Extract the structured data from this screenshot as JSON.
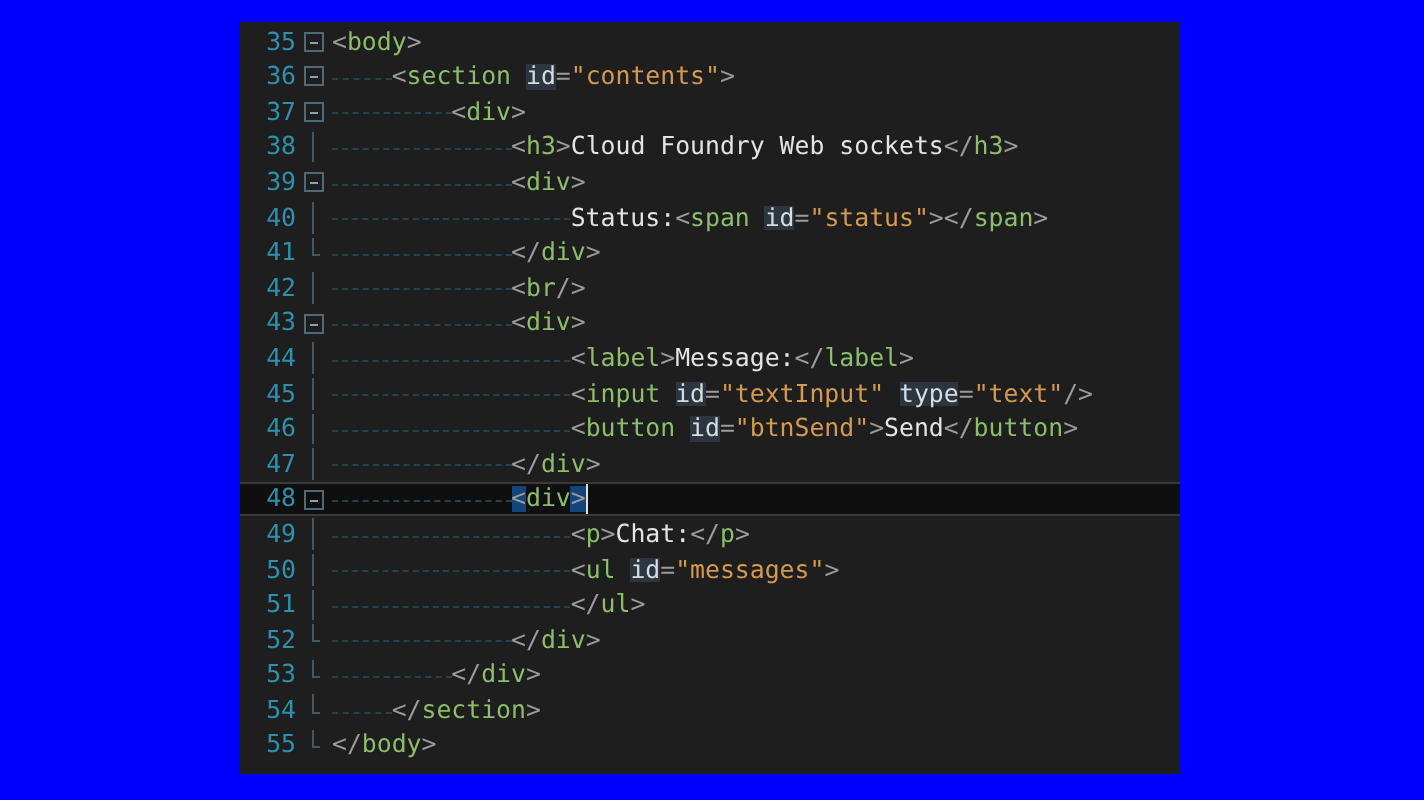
{
  "editor": {
    "lines": [
      {
        "number": "35",
        "collapsible": true,
        "block_end": false,
        "current": false,
        "tokens": [
          {
            "kind": "punct",
            "text": "<"
          },
          {
            "kind": "tag",
            "text": "body"
          },
          {
            "kind": "punct",
            "text": ">"
          }
        ],
        "children": [
          {
            "number": "36",
            "collapsible": true,
            "block_end": false,
            "current": false,
            "tokens": [
              {
                "kind": "punct",
                "text": "<"
              },
              {
                "kind": "tag",
                "text": "section "
              },
              {
                "kind": "attr",
                "text": "id"
              },
              {
                "kind": "punct",
                "text": "="
              },
              {
                "kind": "string",
                "text": "\"contents\""
              },
              {
                "kind": "punct",
                "text": ">"
              }
            ],
            "children": [
              {
                "number": "37",
                "collapsible": true,
                "block_end": false,
                "current": false,
                "tokens": [
                  {
                    "kind": "punct",
                    "text": "<"
                  },
                  {
                    "kind": "tag",
                    "text": "div"
                  },
                  {
                    "kind": "punct",
                    "text": ">"
                  }
                ],
                "children": [
                  {
                    "number": "38",
                    "collapsible": false,
                    "block_end": false,
                    "current": false,
                    "tokens": [
                      {
                        "kind": "punct",
                        "text": "<"
                      },
                      {
                        "kind": "tag",
                        "text": "h3"
                      },
                      {
                        "kind": "punct",
                        "text": ">"
                      },
                      {
                        "kind": "text",
                        "text": "Cloud Foundry Web sockets"
                      },
                      {
                        "kind": "punct",
                        "text": "</"
                      },
                      {
                        "kind": "tag",
                        "text": "h3"
                      },
                      {
                        "kind": "punct",
                        "text": ">"
                      }
                    ]
                  },
                  {
                    "number": "39",
                    "collapsible": true,
                    "block_end": false,
                    "current": false,
                    "tokens": [
                      {
                        "kind": "punct",
                        "text": "<"
                      },
                      {
                        "kind": "tag",
                        "text": "div"
                      },
                      {
                        "kind": "punct",
                        "text": ">"
                      }
                    ],
                    "children": [
                      {
                        "number": "40",
                        "collapsible": false,
                        "block_end": false,
                        "current": false,
                        "tokens": [
                          {
                            "kind": "text",
                            "text": "Status:"
                          },
                          {
                            "kind": "punct",
                            "text": "<"
                          },
                          {
                            "kind": "tag",
                            "text": "span "
                          },
                          {
                            "kind": "attr",
                            "text": "id"
                          },
                          {
                            "kind": "punct",
                            "text": "="
                          },
                          {
                            "kind": "string",
                            "text": "\"status\""
                          },
                          {
                            "kind": "punct",
                            "text": "></"
                          },
                          {
                            "kind": "tag",
                            "text": "span"
                          },
                          {
                            "kind": "punct",
                            "text": ">"
                          }
                        ]
                      }
                    ]
                  },
                  {
                    "number": "41",
                    "collapsible": false,
                    "block_end": true,
                    "current": false,
                    "tokens": [
                      {
                        "kind": "punct",
                        "text": "</"
                      },
                      {
                        "kind": "tag",
                        "text": "div"
                      },
                      {
                        "kind": "punct",
                        "text": ">"
                      }
                    ]
                  },
                  {
                    "number": "42",
                    "collapsible": false,
                    "block_end": false,
                    "current": false,
                    "tokens": [
                      {
                        "kind": "punct",
                        "text": "<"
                      },
                      {
                        "kind": "tag",
                        "text": "br"
                      },
                      {
                        "kind": "punct",
                        "text": "/>"
                      }
                    ]
                  },
                  {
                    "number": "43",
                    "collapsible": true,
                    "block_end": false,
                    "current": false,
                    "tokens": [
                      {
                        "kind": "punct",
                        "text": "<"
                      },
                      {
                        "kind": "tag",
                        "text": "div"
                      },
                      {
                        "kind": "punct",
                        "text": ">"
                      }
                    ],
                    "children": [
                      {
                        "number": "44",
                        "collapsible": false,
                        "block_end": false,
                        "current": false,
                        "tokens": [
                          {
                            "kind": "punct",
                            "text": "<"
                          },
                          {
                            "kind": "tag",
                            "text": "label"
                          },
                          {
                            "kind": "punct",
                            "text": ">"
                          },
                          {
                            "kind": "text",
                            "text": "Message:"
                          },
                          {
                            "kind": "punct",
                            "text": "</"
                          },
                          {
                            "kind": "tag",
                            "text": "label"
                          },
                          {
                            "kind": "punct",
                            "text": ">"
                          }
                        ]
                      },
                      {
                        "number": "45",
                        "collapsible": false,
                        "block_end": false,
                        "current": false,
                        "tokens": [
                          {
                            "kind": "punct",
                            "text": "<"
                          },
                          {
                            "kind": "tag",
                            "text": "input "
                          },
                          {
                            "kind": "attr",
                            "text": "id"
                          },
                          {
                            "kind": "punct",
                            "text": "="
                          },
                          {
                            "kind": "string",
                            "text": "\"textInput\" "
                          },
                          {
                            "kind": "attr",
                            "text": "type"
                          },
                          {
                            "kind": "punct",
                            "text": "="
                          },
                          {
                            "kind": "string",
                            "text": "\"text\""
                          },
                          {
                            "kind": "punct",
                            "text": "/>"
                          }
                        ]
                      },
                      {
                        "number": "46",
                        "collapsible": false,
                        "block_end": false,
                        "current": false,
                        "tokens": [
                          {
                            "kind": "punct",
                            "text": "<"
                          },
                          {
                            "kind": "tag",
                            "text": "button "
                          },
                          {
                            "kind": "attr",
                            "text": "id"
                          },
                          {
                            "kind": "punct",
                            "text": "="
                          },
                          {
                            "kind": "string",
                            "text": "\"btnSend\""
                          },
                          {
                            "kind": "punct",
                            "text": ">"
                          },
                          {
                            "kind": "text",
                            "text": "Send"
                          },
                          {
                            "kind": "punct",
                            "text": "</"
                          },
                          {
                            "kind": "tag",
                            "text": "button"
                          },
                          {
                            "kind": "punct",
                            "text": ">"
                          }
                        ]
                      }
                    ]
                  },
                  {
                    "number": "47",
                    "collapsible": false,
                    "block_end": false,
                    "current": false,
                    "tokens": [
                      {
                        "kind": "punct",
                        "text": "</"
                      },
                      {
                        "kind": "tag",
                        "text": "div"
                      },
                      {
                        "kind": "punct",
                        "text": ">"
                      }
                    ]
                  },
                  {
                    "number": "48",
                    "collapsible": true,
                    "block_end": false,
                    "current": true,
                    "tokens": [
                      {
                        "kind": "match",
                        "text": "<"
                      },
                      {
                        "kind": "tag",
                        "text": "div"
                      },
                      {
                        "kind": "match",
                        "text": ">"
                      }
                    ],
                    "children": [
                      {
                        "number": "49",
                        "collapsible": false,
                        "block_end": false,
                        "current": false,
                        "tokens": [
                          {
                            "kind": "punct",
                            "text": "<"
                          },
                          {
                            "kind": "tag",
                            "text": "p"
                          },
                          {
                            "kind": "punct",
                            "text": ">"
                          },
                          {
                            "kind": "text",
                            "text": "Chat:"
                          },
                          {
                            "kind": "punct",
                            "text": "</"
                          },
                          {
                            "kind": "tag",
                            "text": "p"
                          },
                          {
                            "kind": "punct",
                            "text": ">"
                          }
                        ]
                      },
                      {
                        "number": "50",
                        "collapsible": false,
                        "block_end": false,
                        "current": false,
                        "tokens": [
                          {
                            "kind": "punct",
                            "text": "<"
                          },
                          {
                            "kind": "tag",
                            "text": "ul "
                          },
                          {
                            "kind": "attr",
                            "text": "id"
                          },
                          {
                            "kind": "punct",
                            "text": "="
                          },
                          {
                            "kind": "string",
                            "text": "\"messages\""
                          },
                          {
                            "kind": "punct",
                            "text": ">"
                          }
                        ]
                      },
                      {
                        "number": "51",
                        "collapsible": false,
                        "block_end": false,
                        "current": false,
                        "tokens": [
                          {
                            "kind": "punct",
                            "text": "</"
                          },
                          {
                            "kind": "tag",
                            "text": "ul"
                          },
                          {
                            "kind": "punct",
                            "text": ">"
                          }
                        ]
                      }
                    ]
                  },
                  {
                    "number": "52",
                    "collapsible": false,
                    "block_end": true,
                    "current": false,
                    "tokens": [
                      {
                        "kind": "punct",
                        "text": "</"
                      },
                      {
                        "kind": "tag",
                        "text": "div"
                      },
                      {
                        "kind": "punct",
                        "text": ">"
                      }
                    ]
                  }
                ]
              },
              {
                "number": "53",
                "collapsible": false,
                "block_end": true,
                "current": false,
                "tokens": [
                  {
                    "kind": "punct",
                    "text": "</"
                  },
                  {
                    "kind": "tag",
                    "text": "div"
                  },
                  {
                    "kind": "punct",
                    "text": ">"
                  }
                ]
              }
            ]
          },
          {
            "number": "54",
            "collapsible": false,
            "block_end": true,
            "current": false,
            "tokens": [
              {
                "kind": "punct",
                "text": "</"
              },
              {
                "kind": "tag",
                "text": "section"
              },
              {
                "kind": "punct",
                "text": ">"
              }
            ]
          }
        ]
      },
      {
        "number": "55",
        "collapsible": false,
        "block_end": true,
        "current": false,
        "tokens": [
          {
            "kind": "punct",
            "text": "</"
          },
          {
            "kind": "tag",
            "text": "body"
          },
          {
            "kind": "punct",
            "text": ">"
          }
        ]
      }
    ]
  }
}
